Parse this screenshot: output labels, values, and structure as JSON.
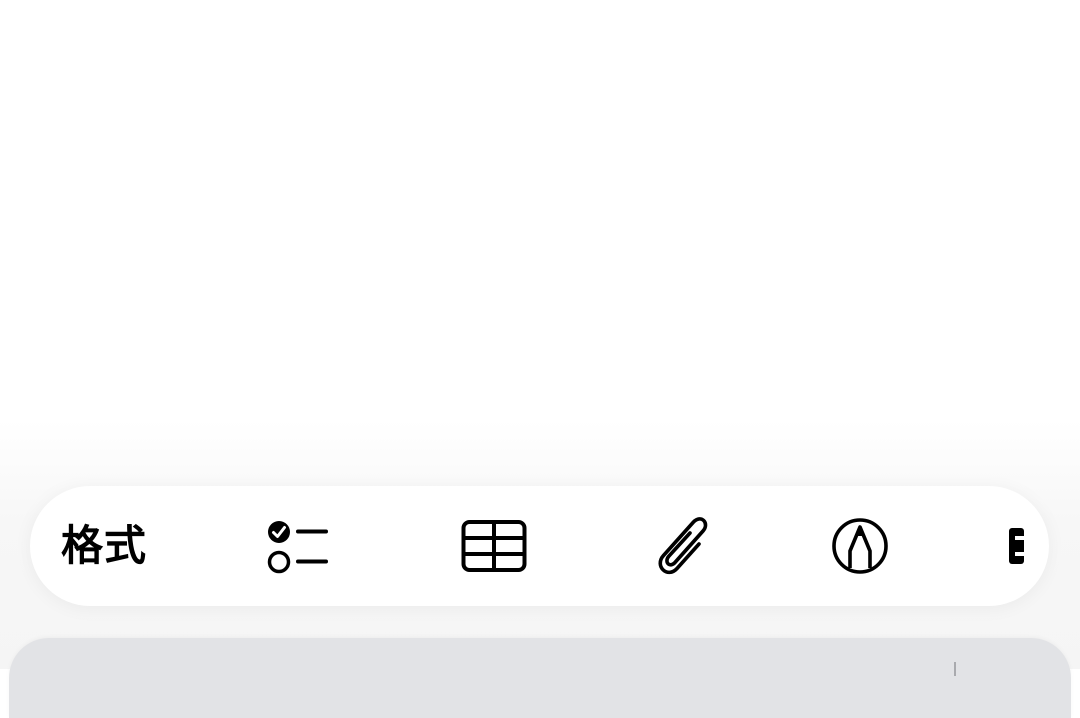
{
  "toolbar": {
    "format_label": "格式",
    "items": [
      {
        "name": "format",
        "label": "格式"
      },
      {
        "name": "checklist",
        "icon": "checklist-icon"
      },
      {
        "name": "table",
        "icon": "table-icon"
      },
      {
        "name": "attachment",
        "icon": "paperclip-icon"
      },
      {
        "name": "markup",
        "icon": "pen-tip-circle-icon"
      },
      {
        "name": "more",
        "icon": "partially-visible-icon"
      }
    ]
  },
  "colors": {
    "background": "#ffffff",
    "toolbar_bg": "#ffffff",
    "icon": "#000000",
    "keyboard_panel": "#e2e3e6"
  }
}
